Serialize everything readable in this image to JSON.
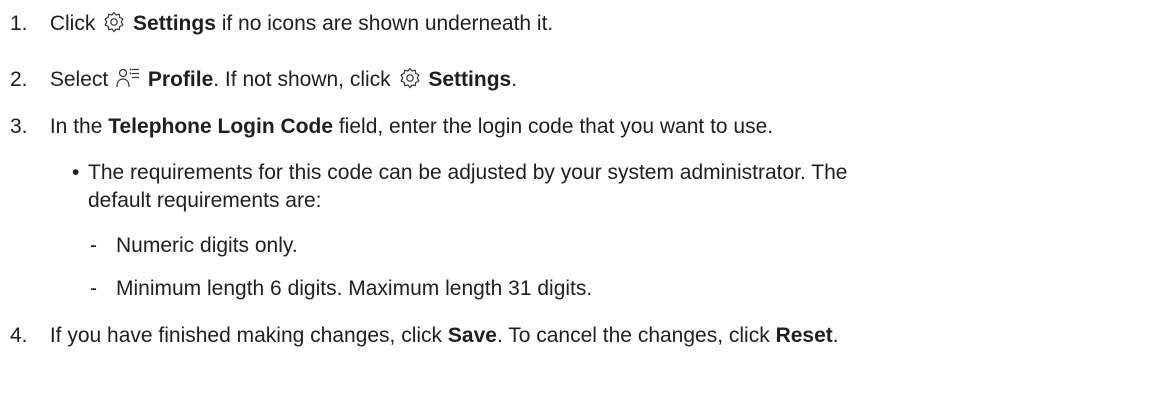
{
  "steps": [
    {
      "num": "1.",
      "pre": "Click",
      "icon": "gear-icon",
      "bold": "Settings",
      "post": "if no icons are shown underneath it."
    },
    {
      "num": "2.",
      "pre": "Select",
      "icon": "profile-list-icon",
      "bold": "Profile",
      "mid": ". If not shown, click",
      "icon2": "gear-icon",
      "bold2": "Settings",
      "post": "."
    },
    {
      "num": "3.",
      "pre": "In the",
      "bold": "Telephone Login Code",
      "post": "field, enter the login code that you want to use."
    },
    {
      "num": "4.",
      "pre": "If you have finished making changes, click",
      "bold": "Save",
      "mid": ". To cancel the changes, click",
      "bold2": "Reset",
      "post": "."
    }
  ],
  "bullet": {
    "marker": "•",
    "line1": "The requirements for this code can be adjusted by your system administrator. The",
    "line2": "default requirements are:"
  },
  "sub_items": [
    {
      "marker": "-",
      "text": "Numeric digits only."
    },
    {
      "marker": "-",
      "text": "Minimum length 6 digits. Maximum length 31 digits."
    }
  ]
}
